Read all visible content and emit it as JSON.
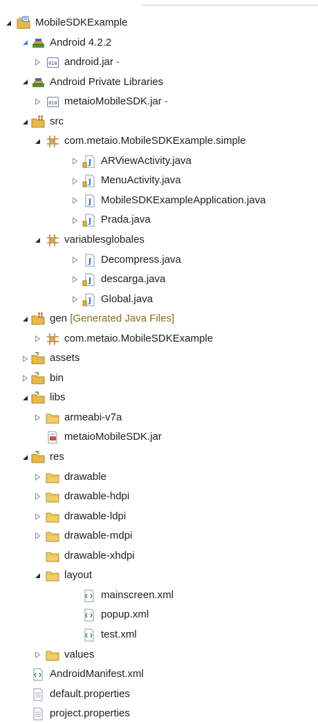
{
  "colors": {
    "expanded_arrow": "#1c5c9e",
    "collapsed_arrow": "#9a9a9a",
    "decoration": "#8b6a1f",
    "folder": "#e7b94c",
    "package": "#b8843a",
    "java_icon": "#2b63ab"
  },
  "tree": [
    {
      "depth": 0,
      "state": "expanded",
      "icon": "project-folder-icon",
      "label": "MobileSDKExample",
      "suffix": "",
      "decoration": ""
    },
    {
      "depth": 1,
      "state": "expanded-blue",
      "icon": "library-container-icon",
      "label": "Android 4.2.2",
      "suffix": "",
      "decoration": ""
    },
    {
      "depth": 2,
      "state": "collapsed",
      "icon": "jar-icon",
      "label": "android.jar",
      "suffix": " -",
      "decoration": ""
    },
    {
      "depth": 1,
      "state": "expanded",
      "icon": "library-container-icon",
      "label": "Android Private Libraries",
      "suffix": "",
      "decoration": ""
    },
    {
      "depth": 2,
      "state": "collapsed",
      "icon": "jar-icon",
      "label": "metaioMobileSDK.jar",
      "suffix": " -",
      "decoration": ""
    },
    {
      "depth": 1,
      "state": "expanded",
      "icon": "source-folder-icon",
      "label": "src",
      "suffix": "",
      "decoration": ""
    },
    {
      "depth": 2,
      "state": "expanded",
      "icon": "package-icon",
      "label": "com.metaio.MobileSDKExample.simple",
      "suffix": "",
      "decoration": ""
    },
    {
      "depth": 3,
      "state": "collapsed",
      "icon": "java-file-icon",
      "label": "ARViewActivity.java",
      "suffix": "",
      "decoration": ""
    },
    {
      "depth": 3,
      "state": "collapsed",
      "icon": "java-file-icon",
      "label": "MenuActivity.java",
      "suffix": "",
      "decoration": ""
    },
    {
      "depth": 3,
      "state": "collapsed",
      "icon": "java-file-plain-icon",
      "label": "MobileSDKExampleApplication.java",
      "suffix": "",
      "decoration": ""
    },
    {
      "depth": 3,
      "state": "collapsed",
      "icon": "java-file-icon",
      "label": "Prada.java",
      "suffix": "",
      "decoration": ""
    },
    {
      "depth": 2,
      "state": "expanded",
      "icon": "package-icon",
      "label": "variablesglobales",
      "suffix": "",
      "decoration": ""
    },
    {
      "depth": 3,
      "state": "collapsed",
      "icon": "java-file-plain-icon",
      "label": "Decompress.java",
      "suffix": "",
      "decoration": ""
    },
    {
      "depth": 3,
      "state": "collapsed",
      "icon": "java-file-icon",
      "label": "descarga.java",
      "suffix": "",
      "decoration": ""
    },
    {
      "depth": 3,
      "state": "collapsed",
      "icon": "java-file-icon",
      "label": "Global.java",
      "suffix": "",
      "decoration": ""
    },
    {
      "depth": 1,
      "state": "expanded",
      "icon": "generated-folder-icon",
      "label": "gen",
      "suffix": "",
      "decoration": "[Generated Java Files]"
    },
    {
      "depth": 2,
      "state": "collapsed",
      "icon": "package-icon",
      "label": "com.metaio.MobileSDKExample",
      "suffix": "",
      "decoration": ""
    },
    {
      "depth": 1,
      "state": "collapsed",
      "icon": "folder-icon",
      "label": "assets",
      "suffix": "",
      "decoration": ""
    },
    {
      "depth": 1,
      "state": "collapsed",
      "icon": "folder-icon",
      "label": "bin",
      "suffix": "",
      "decoration": ""
    },
    {
      "depth": 1,
      "state": "expanded",
      "icon": "folder-icon",
      "label": "libs",
      "suffix": "",
      "decoration": ""
    },
    {
      "depth": 2,
      "state": "collapsed",
      "icon": "plain-folder-icon",
      "label": "armeabi-v7a",
      "suffix": "",
      "decoration": ""
    },
    {
      "depth": 2,
      "state": "none",
      "icon": "jar-file-icon",
      "label": "metaioMobileSDK.jar",
      "suffix": "",
      "decoration": ""
    },
    {
      "depth": 1,
      "state": "expanded",
      "icon": "folder-icon",
      "label": "res",
      "suffix": "",
      "decoration": ""
    },
    {
      "depth": 2,
      "state": "collapsed",
      "icon": "plain-folder-icon",
      "label": "drawable",
      "suffix": "",
      "decoration": ""
    },
    {
      "depth": 2,
      "state": "collapsed",
      "icon": "plain-folder-icon",
      "label": "drawable-hdpi",
      "suffix": "",
      "decoration": ""
    },
    {
      "depth": 2,
      "state": "collapsed",
      "icon": "plain-folder-icon",
      "label": "drawable-ldpi",
      "suffix": "",
      "decoration": ""
    },
    {
      "depth": 2,
      "state": "collapsed",
      "icon": "plain-folder-icon",
      "label": "drawable-mdpi",
      "suffix": "",
      "decoration": ""
    },
    {
      "depth": 2,
      "state": "none",
      "icon": "plain-folder-icon",
      "label": "drawable-xhdpi",
      "suffix": "",
      "decoration": ""
    },
    {
      "depth": 2,
      "state": "expanded",
      "icon": "plain-folder-icon",
      "label": "layout",
      "suffix": "",
      "decoration": ""
    },
    {
      "depth": 3,
      "state": "none",
      "icon": "xml-file-icon",
      "label": "mainscreen.xml",
      "suffix": "",
      "decoration": ""
    },
    {
      "depth": 3,
      "state": "none",
      "icon": "xml-file-icon",
      "label": "popup.xml",
      "suffix": "",
      "decoration": ""
    },
    {
      "depth": 3,
      "state": "none",
      "icon": "xml-file-icon",
      "label": "test.xml",
      "suffix": "",
      "decoration": ""
    },
    {
      "depth": 2,
      "state": "collapsed",
      "icon": "plain-folder-icon",
      "label": "values",
      "suffix": "",
      "decoration": ""
    },
    {
      "depth": 1,
      "state": "none",
      "icon": "xml-file-icon",
      "label": "AndroidManifest.xml",
      "suffix": "",
      "decoration": ""
    },
    {
      "depth": 1,
      "state": "none",
      "icon": "text-file-icon",
      "label": "default.properties",
      "suffix": "",
      "decoration": ""
    },
    {
      "depth": 1,
      "state": "none",
      "icon": "text-file-icon",
      "label": "project.properties",
      "suffix": "",
      "decoration": ""
    }
  ]
}
